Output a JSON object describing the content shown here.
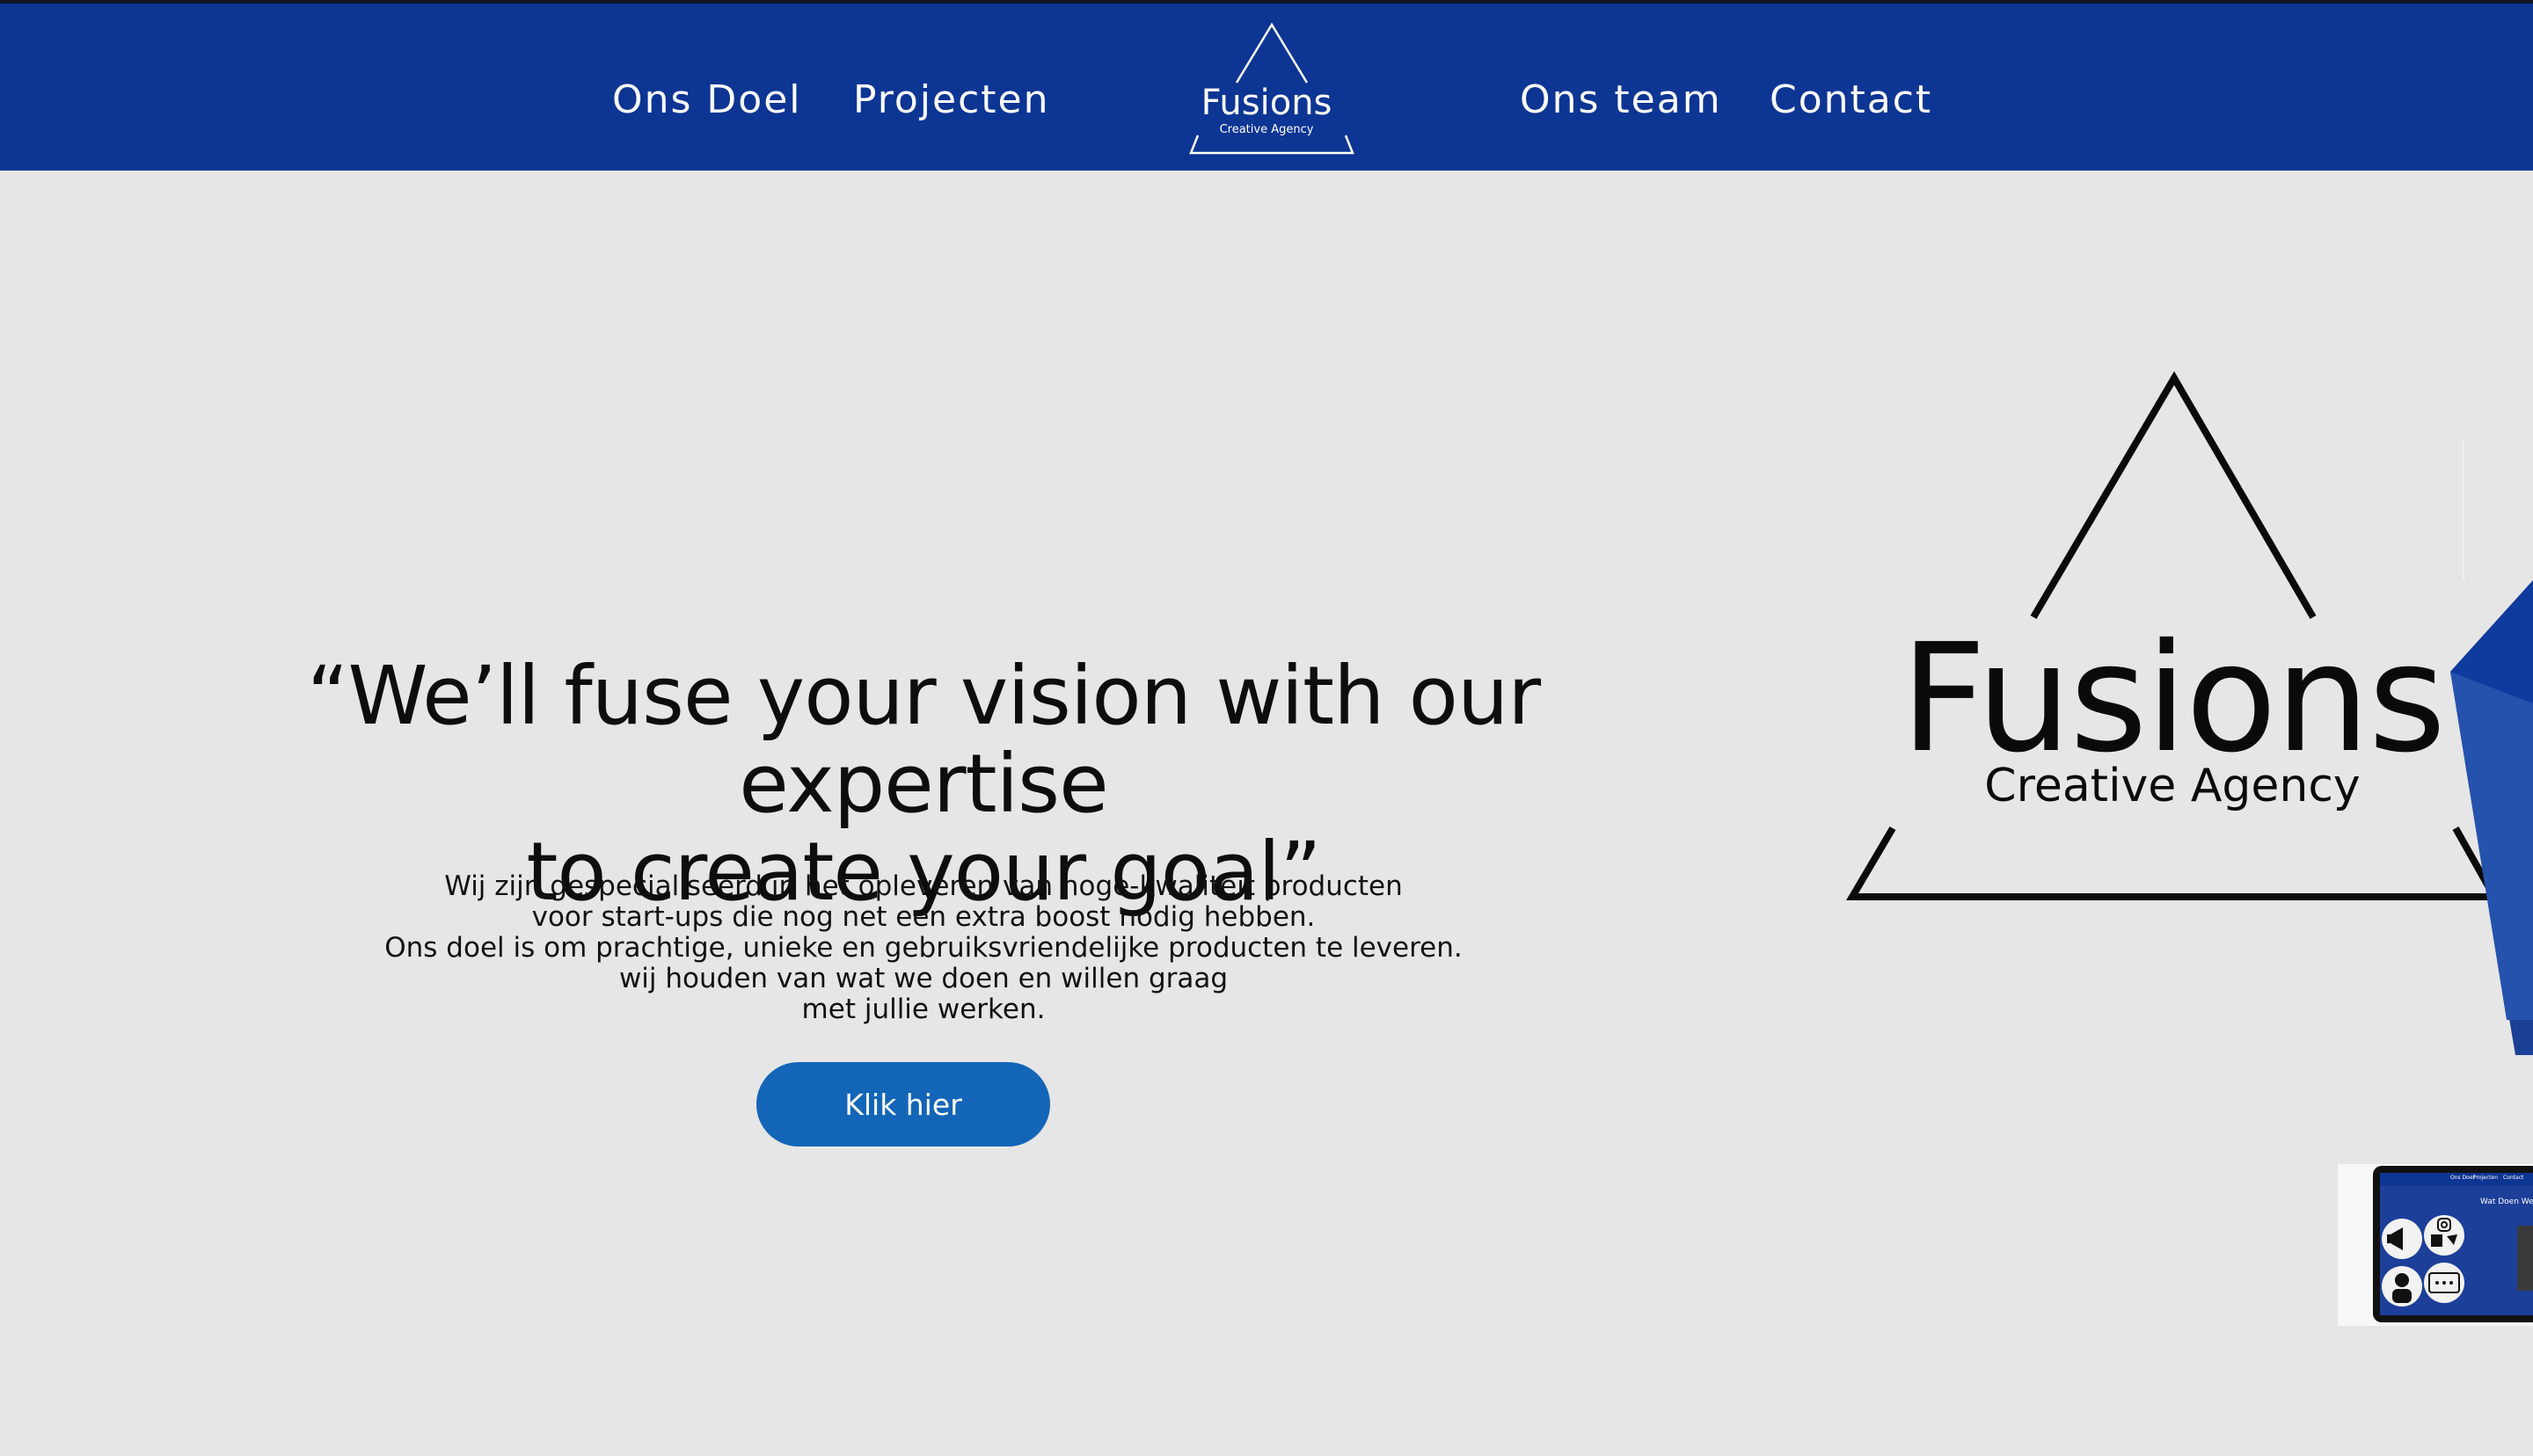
{
  "nav": {
    "links_left": [
      "Ons Doel",
      "Projecten"
    ],
    "links_right": [
      "Ons team",
      "Contact"
    ],
    "logo": {
      "name": "Fusions",
      "tagline": "Creative Agency"
    }
  },
  "hero": {
    "quote_lines": [
      "“We’ll fuse your vision with our expertise",
      "to create your goal”"
    ],
    "text_lines": [
      "Wij zijn gespecialiseerd in het opleveren van hoge-kwaliteit producten",
      "voor start-ups die nog net een extra boost nodig hebben.",
      "Ons doel is om prachtige, unieke en gebruiksvriendelijke producten te leveren.",
      "wij houden van wat we doen en willen graag",
      "met jullie werken."
    ],
    "cta_label": "Klik hier"
  },
  "brand": {
    "name": "Fusions",
    "tagline": "Creative Agency"
  },
  "preview": {
    "nav_items": [
      "Ons Doel",
      "Projecten",
      "Contact"
    ],
    "title": "Wat Doen We"
  },
  "colors": {
    "nav_background": "#0d3593",
    "page_background": "#e6e6e6",
    "button": "#1365b8"
  },
  "icons": [
    "triangle-logo-icon",
    "megaphone-icon",
    "instagram-icon",
    "facebook-icon",
    "twitter-icon",
    "person-icon",
    "chat-icon"
  ]
}
